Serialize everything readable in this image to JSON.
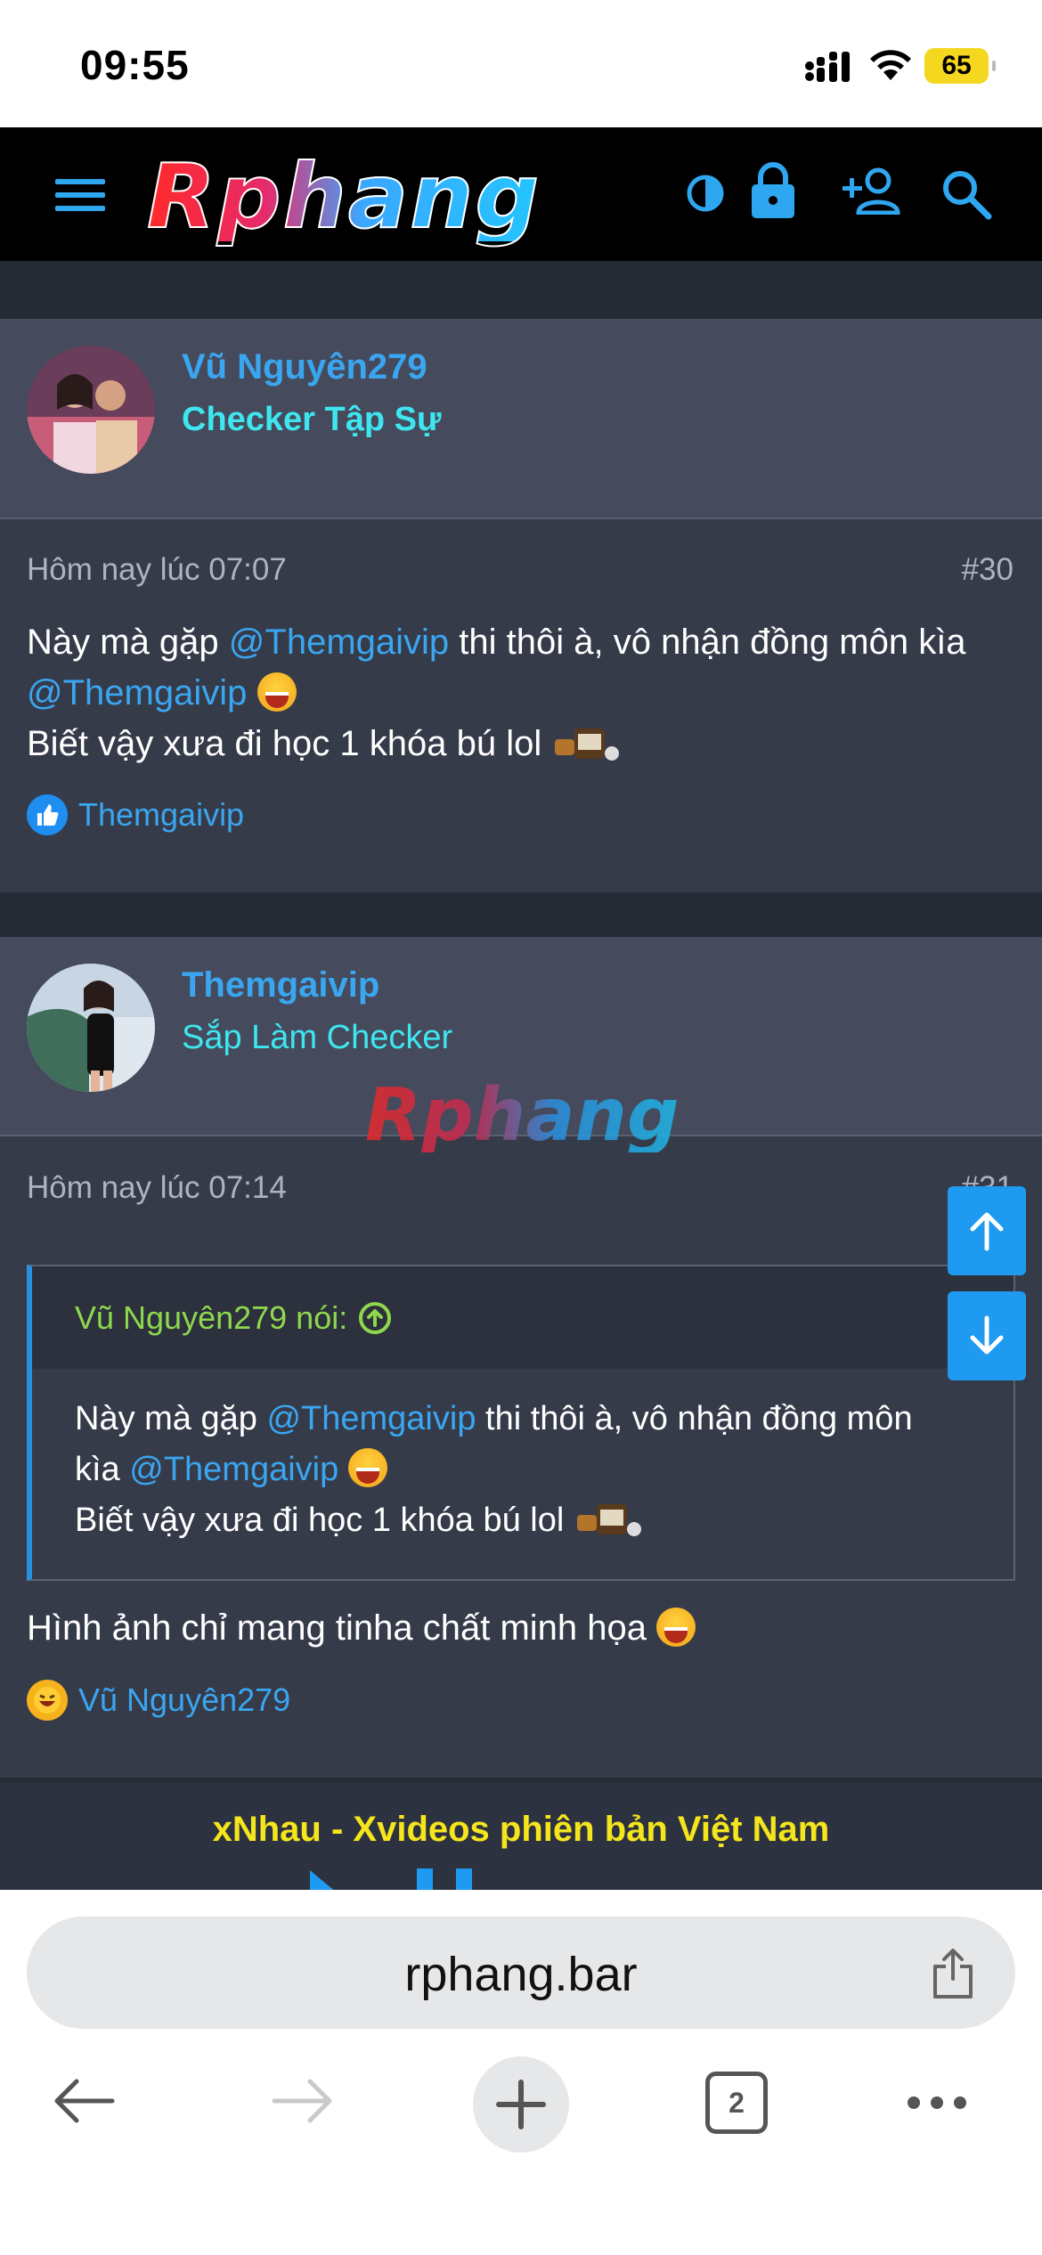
{
  "status_bar": {
    "time": "09:55",
    "battery": "65"
  },
  "site": {
    "logo_text": "Rphang",
    "watermark_text": "Rphang"
  },
  "posts": [
    {
      "author": "Vũ Nguyên279",
      "rank": "Checker Tập Sự",
      "date": "Hôm nay lúc 07:07",
      "number": "#30",
      "text_line1_a": "Này mà gặp ",
      "mention1": "@Themgaivip",
      "text_line1_b": " thi thôi à, vô nhận đồng môn kìa",
      "mention2": "@Themgaivip",
      "text_line2": "Biết vậy xưa đi học 1 khóa bú lol",
      "reaction_user": "Themgaivip"
    },
    {
      "author": "Themgaivip",
      "rank": "Sắp Làm Checker",
      "date": "Hôm nay lúc 07:14",
      "number": "#31",
      "quote": {
        "header": "Vũ Nguyên279 nói:",
        "line1_a": "Này mà gặp ",
        "mention1": "@Themgaivip",
        "line1_b": " thi thôi à, vô nhận đồng môn",
        "line2_a": "kìa ",
        "mention2": "@Themgaivip",
        "line3": "Biết vậy xưa đi học 1 khóa bú lol"
      },
      "text": "Hình ảnh chỉ mang tinha chất minh họa",
      "reaction_user": "Vũ Nguyên279"
    }
  ],
  "ad": {
    "title": "xNhau - Xvideos phiên bản Việt Nam"
  },
  "browser": {
    "url": "rphang.bar",
    "tab_count": "2"
  }
}
